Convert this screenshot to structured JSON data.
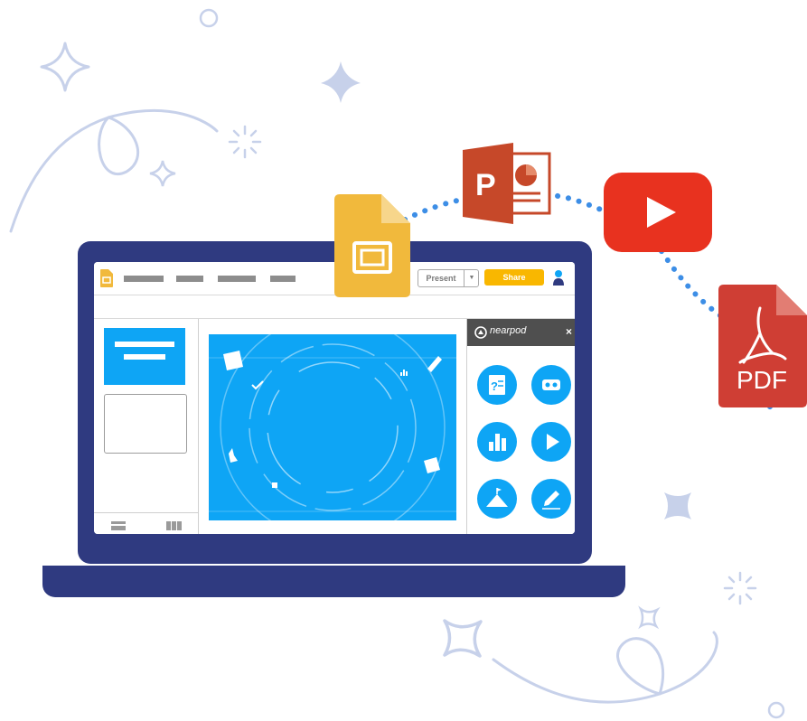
{
  "toolbar": {
    "present_label": "Present",
    "share_label": "Share"
  },
  "nearpod": {
    "brand": "nearpod",
    "close": "×"
  },
  "file_types": {
    "pdf_label": "PDF",
    "powerpoint_letter": "P"
  },
  "icons": {
    "slides": "google-slides-icon",
    "powerpoint": "powerpoint-icon",
    "youtube": "youtube-icon",
    "pdf": "pdf-icon"
  },
  "colors": {
    "laptop": "#2f3a80",
    "slide_blue": "#0ea5f5",
    "share_yellow": "#f9b700",
    "youtube_red": "#e8321f",
    "pdf_red": "#cf3e34",
    "powerpoint_orange": "#c64829",
    "slides_yellow": "#f1b93c",
    "dots_blue": "#3d8ee6",
    "decoration": "#c7d1ea"
  }
}
